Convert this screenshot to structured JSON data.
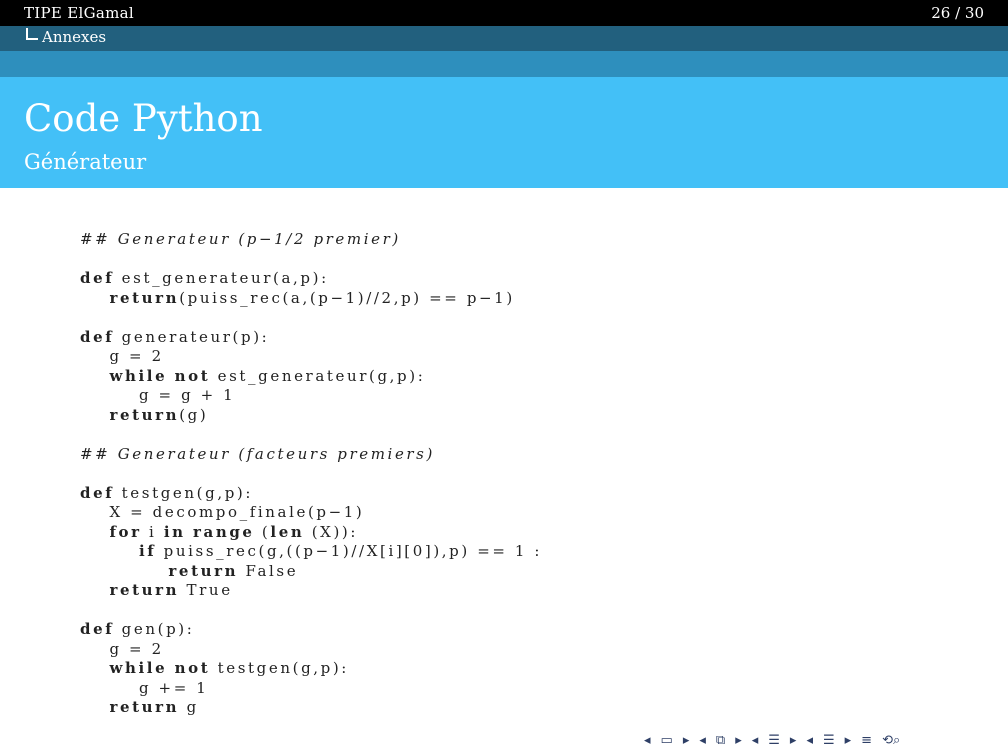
{
  "header": {
    "presentation_title": "TIPE ElGamal",
    "page_counter": "26 / 30",
    "section": "Annexes"
  },
  "frame": {
    "title": "Code Python",
    "subtitle": "Générateur"
  },
  "code_lines": [
    {
      "text": "## Generateur (p−1/2 premier)",
      "style": "comment"
    },
    {
      "text": "",
      "style": "blank"
    },
    {
      "text": "def est_generateur(a,p):",
      "style": "code"
    },
    {
      "text": "    return(puiss_rec(a,(p−1)//2,p) == p−1)",
      "style": "code"
    },
    {
      "text": "",
      "style": "blank"
    },
    {
      "text": "def generateur(p):",
      "style": "code"
    },
    {
      "text": "    g = 2",
      "style": "code"
    },
    {
      "text": "    while not est_generateur(g,p):",
      "style": "code"
    },
    {
      "text": "        g = g + 1",
      "style": "code"
    },
    {
      "text": "    return(g)",
      "style": "code"
    },
    {
      "text": "",
      "style": "blank"
    },
    {
      "text": "## Generateur (facteurs premiers)",
      "style": "comment"
    },
    {
      "text": "",
      "style": "blank"
    },
    {
      "text": "def testgen(g,p):",
      "style": "code"
    },
    {
      "text": "    X = decompo_finale(p−1)",
      "style": "code"
    },
    {
      "text": "    for i in range (len (X)):",
      "style": "code"
    },
    {
      "text": "        if puiss_rec(g,((p−1)//X[i][0]),p) == 1 :",
      "style": "code"
    },
    {
      "text": "            return False",
      "style": "code"
    },
    {
      "text": "    return True",
      "style": "code"
    },
    {
      "text": "",
      "style": "blank"
    },
    {
      "text": "def gen(p):",
      "style": "code"
    },
    {
      "text": "    g = 2",
      "style": "code"
    },
    {
      "text": "    while not testgen(g,p):",
      "style": "code"
    },
    {
      "text": "        g += 1",
      "style": "code"
    },
    {
      "text": "    return g",
      "style": "code"
    }
  ],
  "keywords": [
    "def",
    "return",
    "while",
    "not",
    "for",
    "in",
    "range",
    "len",
    "if"
  ],
  "navigation": {
    "icons": [
      "nav-left-arrow",
      "frame-icon",
      "nav-right-arrow",
      "nav-left-arrow",
      "subsection-icon",
      "nav-right-arrow",
      "nav-left-arrow",
      "section-icon",
      "nav-right-arrow",
      "nav-left-arrow",
      "section-icon",
      "nav-right-arrow",
      "align-icon",
      "search-icon"
    ]
  },
  "colors": {
    "top_bar": "#000000",
    "section_bar": "#22607e",
    "band": "#2e8fbd",
    "title_bar": "#43c0f7",
    "nav": "#2e3f66"
  }
}
